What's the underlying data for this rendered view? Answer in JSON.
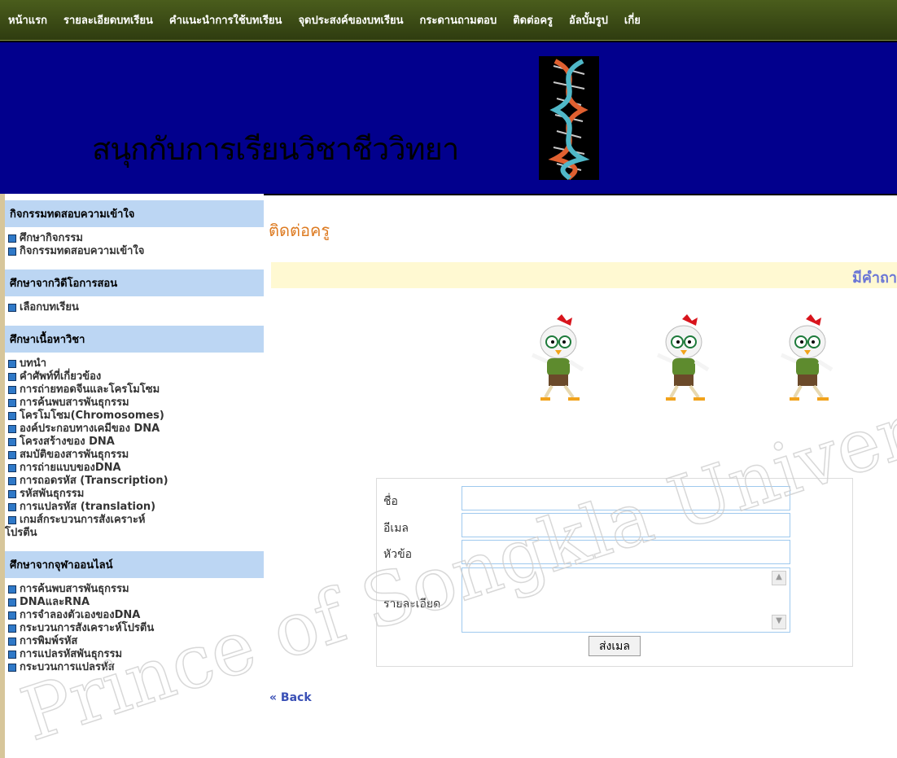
{
  "nav": {
    "items": [
      "หน้าแรก",
      "รายละเอียดบทเรียน",
      "คำแนะนำการใช้บทเรียน",
      "จุดประสงค์ของบทเรียน",
      "กระดานถามตอบ",
      "ติดต่อครู",
      "อัลบั้มรูป",
      "เกี่ย"
    ]
  },
  "banner": {
    "title": "สนุกกับการเรียนวิชาชีววิทยา"
  },
  "sidebar": {
    "sections": [
      {
        "header": "กิจกรรมทดสอบความเข้าใจ",
        "items": [
          "ศึกษากิจกรรม",
          "กิจกรรมทดสอบความเข้าใจ"
        ]
      },
      {
        "header": "ศึกษาจากวิดีโอการสอน",
        "items": [
          "เลือกบทเรียน"
        ]
      },
      {
        "header": "ศึกษาเนื้อหาวิชา",
        "items": [
          "บทนำ",
          "คำศัพท์ที่เกี่ยวข้อง",
          "การถ่ายทอดจีนและโครโมโซม",
          "การค้นพบสารพันธุกรรม",
          "โครโมโซม(Chromosomes)",
          "องค์ประกอบทางเคมีของ DNA",
          "โครงสร้างของ DNA",
          "สมบัติของสารพันธุกรรม",
          "การถ่ายแบบของDNA",
          "การถอดรหัส (Transcription)",
          "รหัสพันธุกรรม",
          "การแปลรหัส (translation)",
          "เกมส์กระบวนการสังเคราะห์",
          "โปรตีน"
        ]
      },
      {
        "header": "ศึกษาจากจุฬาออนไลน์",
        "items": [
          "การค้นพบสารพันธุกรรม",
          "DNAและRNA",
          "การจำลองตัวเองของDNA",
          "กระบวนการสังเคราะห์โปรตีน",
          "การพิมพ์รหัส",
          "การแปลรหัสพันธุกรรม",
          "กระบวนการแปลรหัส"
        ]
      }
    ]
  },
  "main": {
    "title": "ติดต่อครู",
    "ticker": "มีคำถา",
    "form": {
      "name_label": "ชื่อ",
      "email_label": "อีเมล",
      "subject_label": "หัวข้อ",
      "details_label": "รายละเอียด",
      "send_label": "ส่งเมล"
    },
    "back_link": "« Back"
  },
  "watermark": {
    "text": "Prince of Songkla University Trang Campus"
  },
  "colors": {
    "nav_bg": "#3b4a16",
    "banner_bg": "#02008d",
    "sidebar_head": "#bcd6f3",
    "title_orange": "#dd7b22",
    "ticker_bg": "#fff9d2",
    "link": "#3a50b6"
  }
}
